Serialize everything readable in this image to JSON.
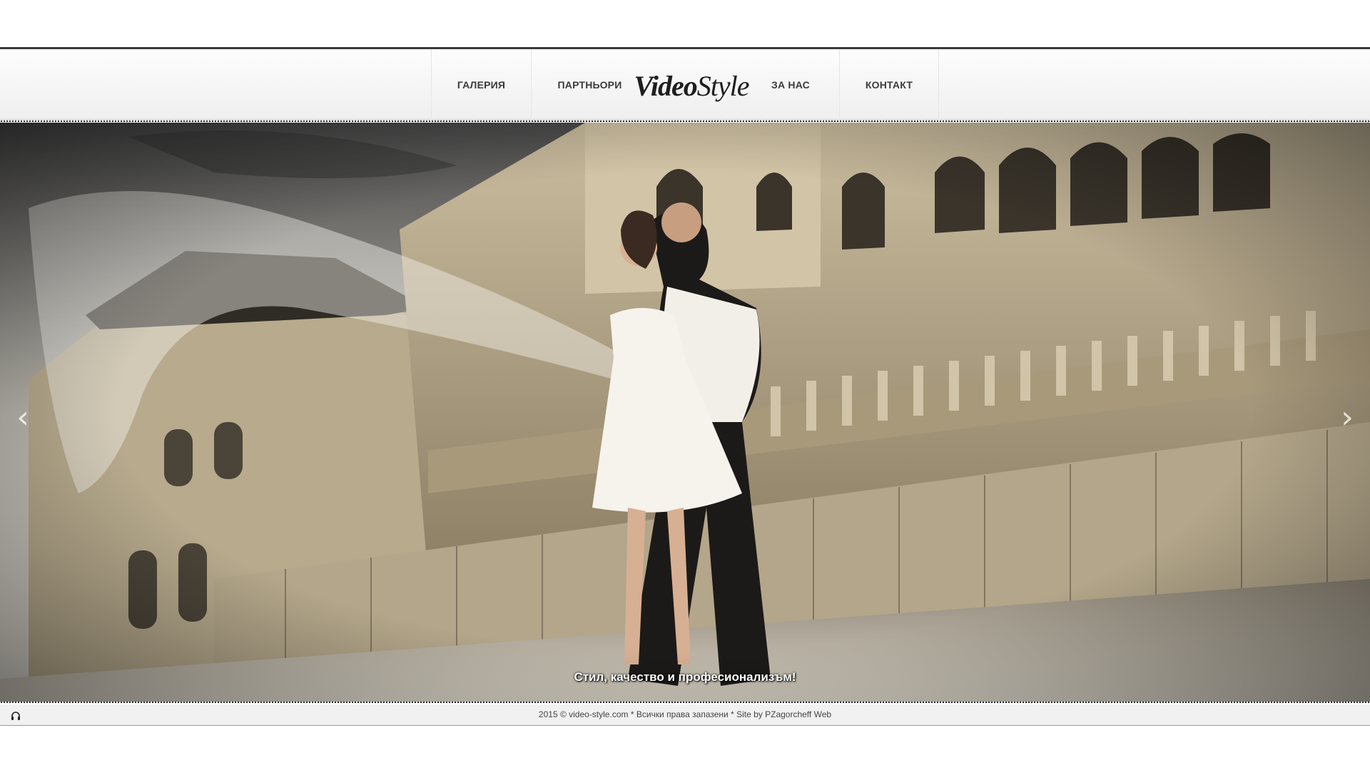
{
  "nav": {
    "items": [
      {
        "label": "ГАЛЕРИЯ"
      },
      {
        "label": "ПАРТНЬОРИ"
      },
      {
        "label": "ЗА НАС"
      },
      {
        "label": "КОНТАКТ"
      }
    ]
  },
  "logo": {
    "part1": "Video",
    "part2": "Style"
  },
  "hero": {
    "caption": "Стил, качество и професионализъм!",
    "prev_icon": "chevron-left-icon",
    "next_icon": "chevron-right-icon"
  },
  "footer": {
    "text": "2015 © video-style.com * Всички права запазени * Site by PZagorcheff Web",
    "audio_icon": "headphones-icon"
  },
  "colors": {
    "nav_text": "#3b3b3b",
    "top_rule": "#3a3a3a",
    "footer_bg": "#f1f1f1"
  }
}
